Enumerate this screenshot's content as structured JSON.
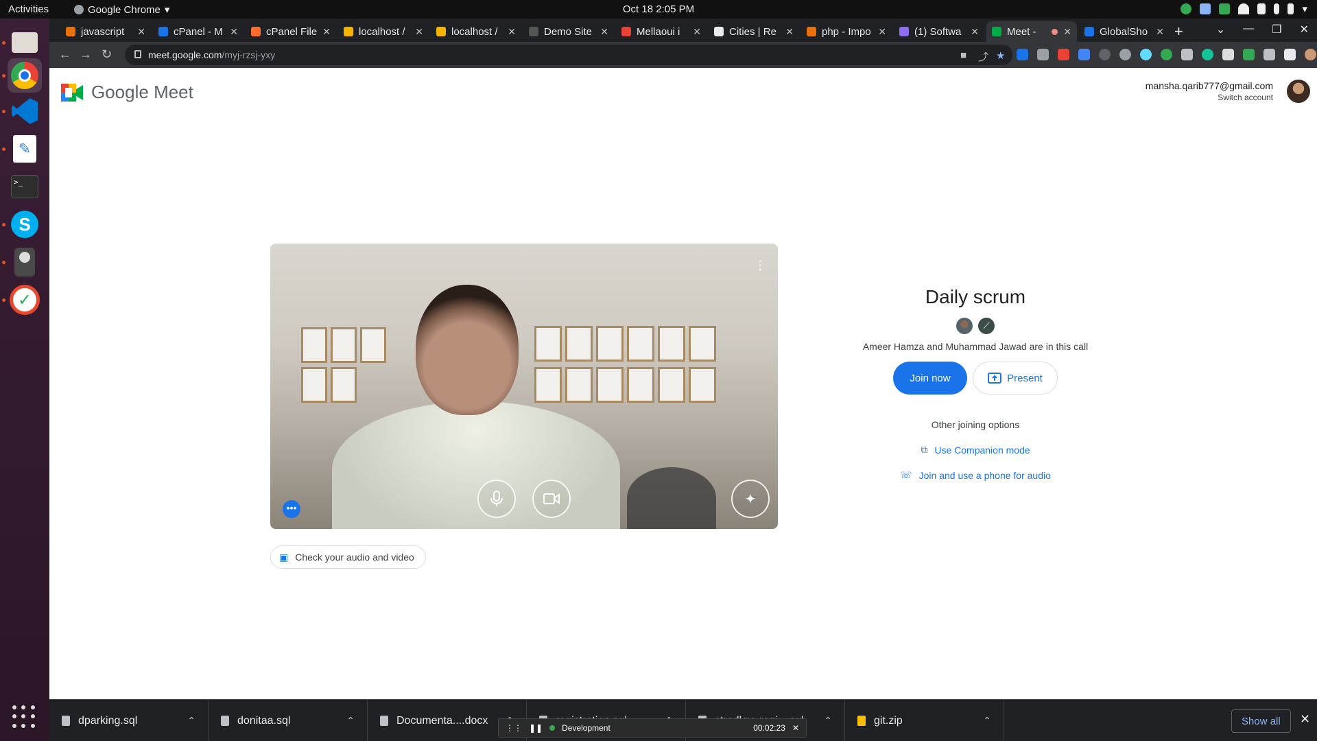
{
  "system": {
    "activities": "Activities",
    "app_menu": "Google Chrome",
    "clock": "Oct 18  2:05 PM"
  },
  "tabs": [
    {
      "label": "javascript",
      "color": "#e8710a"
    },
    {
      "label": "cPanel - M",
      "color": "#1a73e8"
    },
    {
      "label": "cPanel File",
      "color": "#ff6c2c"
    },
    {
      "label": "localhost /",
      "color": "#f4b400"
    },
    {
      "label": "localhost /",
      "color": "#f4b400"
    },
    {
      "label": "Demo Site",
      "color": "#555555"
    },
    {
      "label": "Mellaoui i",
      "color": "#ea4335"
    },
    {
      "label": "Cities | Re",
      "color": "#e8eaed"
    },
    {
      "label": "php - Impo",
      "color": "#e8710a"
    },
    {
      "label": "(1) Softwa",
      "color": "#8f6df2"
    },
    {
      "label": "Meet -",
      "color": "#00ac47"
    },
    {
      "label": "GlobalSho",
      "color": "#1a73e8"
    }
  ],
  "address": {
    "domain": "meet.google.com",
    "path": "/myj-rzsj-yxy"
  },
  "meet": {
    "brand": "Google Meet",
    "account_email": "mansha.qarib777@gmail.com",
    "switch_account": "Switch account",
    "check_av": "Check your audio and video",
    "title": "Daily scrum",
    "in_call": "Ameer Hamza and Muhammad Jawad are in this call",
    "join_now": "Join now",
    "present": "Present",
    "other_options": "Other joining options",
    "companion": "Use Companion mode",
    "phone_audio": "Join and use a phone for audio"
  },
  "downloads": [
    {
      "name": "dparking.sql"
    },
    {
      "name": "donitaa.sql"
    },
    {
      "name": "Documenta....docx"
    },
    {
      "name": "registration.sql"
    },
    {
      "name": "stradley_regi....sql"
    },
    {
      "name": "git.zip"
    }
  ],
  "downloads_show_all": "Show all",
  "devbar": {
    "label": "Development",
    "timer": "00:02:23"
  },
  "colors": {
    "accent": "#1a73e8",
    "dock": "#3b1f36",
    "chrome_dark": "#202124"
  }
}
